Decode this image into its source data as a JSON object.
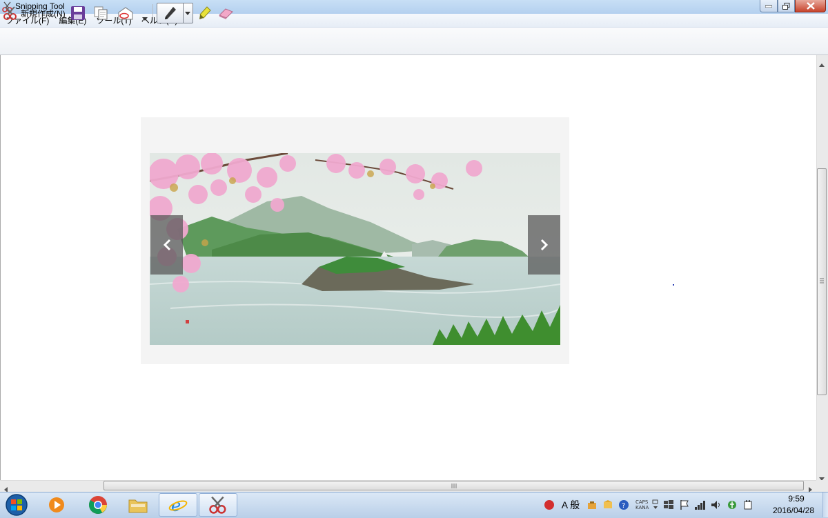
{
  "window": {
    "title": "Snipping Tool"
  },
  "menu": [
    "ファイル(F)",
    "編集(E)",
    "ツール(T)",
    "ヘルプ(H)"
  ],
  "toolbar": {
    "new_label": "新規作成(N)"
  },
  "clock": {
    "time": "9:59",
    "date": "2016/04/28"
  },
  "tray": {
    "ime_label": "A 般",
    "caps": "CAPS",
    "kana": "KANA"
  },
  "colors": {
    "accent": "#b9cfe8",
    "close": "#c7432b",
    "arrow_overlay": "#5a5a5a"
  }
}
